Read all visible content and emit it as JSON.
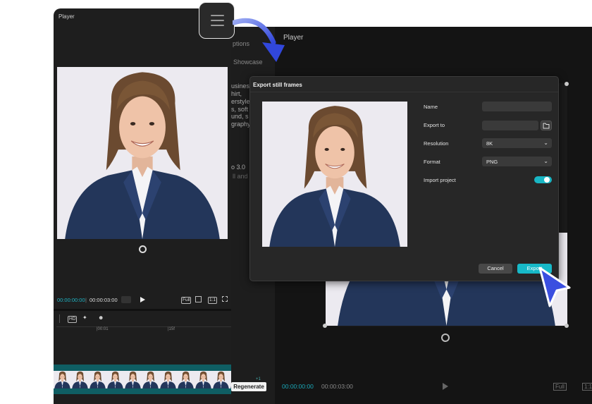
{
  "background_editor": {
    "player_title": "Player",
    "left_snippets": [
      "ptions",
      "Showcase",
      "usines",
      "hirt,",
      "erstyle:",
      "s, soft",
      "und, s",
      "graphy",
      "o 3.0",
      "ll and"
    ],
    "time_current": "00:00:00:00",
    "time_total": "00:00:03:00",
    "controls": [
      "Full",
      "1:1"
    ]
  },
  "player_panel": {
    "title": "Player",
    "time_current": "00:00:00:00",
    "time_separator": "|",
    "time_total": "00:00:03:00",
    "controls": [
      "Full",
      "1:1"
    ],
    "timeline": {
      "tool_hd": "HD",
      "ticks": [
        "|00:01",
        "|15f"
      ]
    }
  },
  "regenerate_button": {
    "label": "Regenerate",
    "badge": "+1"
  },
  "dialog": {
    "title": "Export still frames",
    "fields": {
      "name_label": "Name",
      "name_value": "",
      "export_to_label": "Export to",
      "export_to_value": "",
      "resolution_label": "Resolution",
      "resolution_value": "8K",
      "format_label": "Format",
      "format_value": "PNG",
      "import_project_label": "Import project",
      "import_project_on": true
    },
    "cancel_label": "Cancel",
    "export_label": "Export"
  },
  "icons": {
    "menu": "hamburger-icon",
    "folder": "folder-icon",
    "cursor": "pointer-cursor-icon",
    "arrow": "curved-arrow-icon"
  },
  "colors": {
    "accent": "#17b9c8",
    "pointer": "#3b4fe0",
    "timecode": "#20b5c5"
  }
}
